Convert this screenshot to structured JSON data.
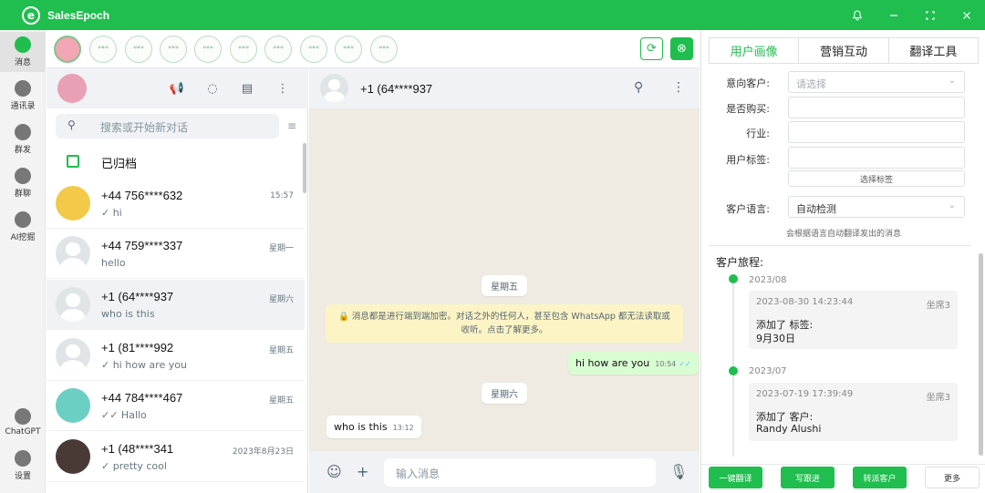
{
  "app": {
    "title": "SalesEpoch",
    "logo_letter": "e",
    "accent": "#1fbe4e"
  },
  "titlebar_icons": [
    "bell-icon",
    "minimize-icon",
    "maximize-icon",
    "close-icon"
  ],
  "nav": [
    {
      "label": "消息",
      "icon": "chat-bubble-icon",
      "active": true
    },
    {
      "label": "通讯录",
      "icon": "contacts-icon"
    },
    {
      "label": "群发",
      "icon": "send-icon"
    },
    {
      "label": "群聊",
      "icon": "group-chat-icon"
    },
    {
      "label": "AI挖掘",
      "icon": "ai-mining-icon"
    },
    {
      "label": "ChatGPT",
      "icon": "openai-icon"
    },
    {
      "label": "设置",
      "icon": "gear-icon"
    }
  ],
  "chatlist": {
    "search_placeholder": "搜索或开始新对话",
    "archived_label": "已归档",
    "chats": [
      {
        "name": "+44 756****632",
        "message": "✓ hi",
        "time": "15:57"
      },
      {
        "name": "+44 759****337",
        "message": "hello",
        "time": "星期一"
      },
      {
        "name": "+1 (64****937",
        "message": "who is this",
        "time": "星期六",
        "selected": true
      },
      {
        "name": "+1 (81****992",
        "message": "✓ hi how are you",
        "time": "星期五"
      },
      {
        "name": "+44 784****467",
        "message": "✓✓ Hallo",
        "time": "星期五"
      },
      {
        "name": "+1 (48****341",
        "message": "✓ pretty cool",
        "time": "2023年8月23日"
      }
    ]
  },
  "chat": {
    "title": "+1 (64****937",
    "date1": "星期五",
    "encryption_notice": "🔒 消息都是进行端到端加密。对话之外的任何人，甚至包含 WhatsApp 都无法读取或收听。点击了解更多。",
    "out_message": {
      "text": "hi how are you",
      "time": "10:54",
      "ticks": "✓✓"
    },
    "date2": "星期六",
    "in_message": {
      "text": "who is this",
      "time": "13:12"
    },
    "input_placeholder": "输入消息"
  },
  "panel": {
    "tabs": [
      "用户画像",
      "营销互动",
      "翻译工具"
    ],
    "active_tab": 0,
    "fields": {
      "intent_label": "意向客户:",
      "intent_placeholder": "请选择",
      "purchased_label": "是否购买:",
      "industry_label": "行业:",
      "tags_label": "用户标签:",
      "select_tags_button": "选择标签",
      "language_label": "客户语言:",
      "language_value": "自动检测",
      "language_note": "会根据语言自动翻译发出的消息"
    },
    "journey": {
      "title": "客户旅程:",
      "entries": [
        {
          "month": "2023/08",
          "timestamp": "2023-08-30 14:23:44",
          "seat": "坐席3",
          "line1": "添加了 标签:",
          "line2": "9月30日"
        },
        {
          "month": "2023/07",
          "timestamp": "2023-07-19 17:39:49",
          "seat": "坐席3",
          "line1": "添加了 客户:",
          "line2": "Randy Alushi"
        }
      ]
    },
    "buttons": [
      "一键翻译",
      "写跟进",
      "转派客户",
      "更多"
    ]
  }
}
